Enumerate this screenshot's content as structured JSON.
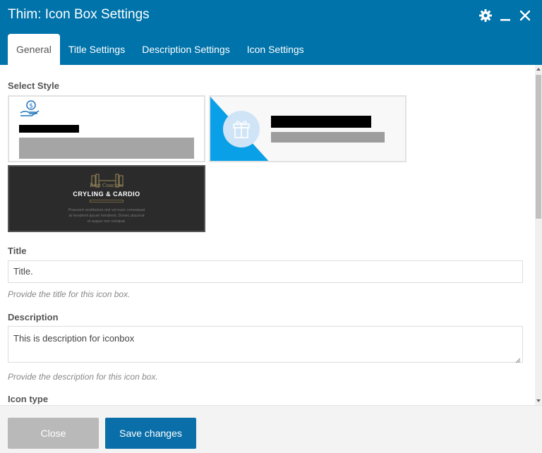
{
  "dialog": {
    "title": "Thim: Icon Box Settings"
  },
  "header_icons": [
    "gear-icon",
    "minimize-icon",
    "close-icon"
  ],
  "tabs": [
    {
      "label": "General",
      "active": true
    },
    {
      "label": "Title Settings",
      "active": false
    },
    {
      "label": "Description Settings",
      "active": false
    },
    {
      "label": "Icon Settings",
      "active": false
    }
  ],
  "form": {
    "select_style_label": "Select Style",
    "style_options": [
      {
        "name": "style-1",
        "icon": "money-hand-icon",
        "selected": false
      },
      {
        "name": "style-2",
        "icon": "gift-icon",
        "selected": false
      },
      {
        "name": "style-3",
        "selected": true,
        "preview_heading": "CRYLING & CARDIO",
        "preview_subheading": "Best Coaches",
        "preview_lines": [
          "Praesent vestibulum nisl vel nunc consequat",
          "at hendrerit ipsum hendrerit. Donec placerat",
          "et augue non volutpat."
        ]
      }
    ],
    "title_label": "Title",
    "title_value": "Title.",
    "title_help": "Provide the title for this icon box.",
    "description_label": "Description",
    "description_value": "This is description for iconbox",
    "description_help": "Provide the description for this icon box.",
    "icon_type_label": "Icon type"
  },
  "footer": {
    "close_label": "Close",
    "save_label": "Save changes"
  },
  "colors": {
    "header_bg": "#0073aa",
    "save_bg": "#0a6fa9",
    "close_bg": "#b9b9b9",
    "accent_blue": "#0aa0e8"
  }
}
